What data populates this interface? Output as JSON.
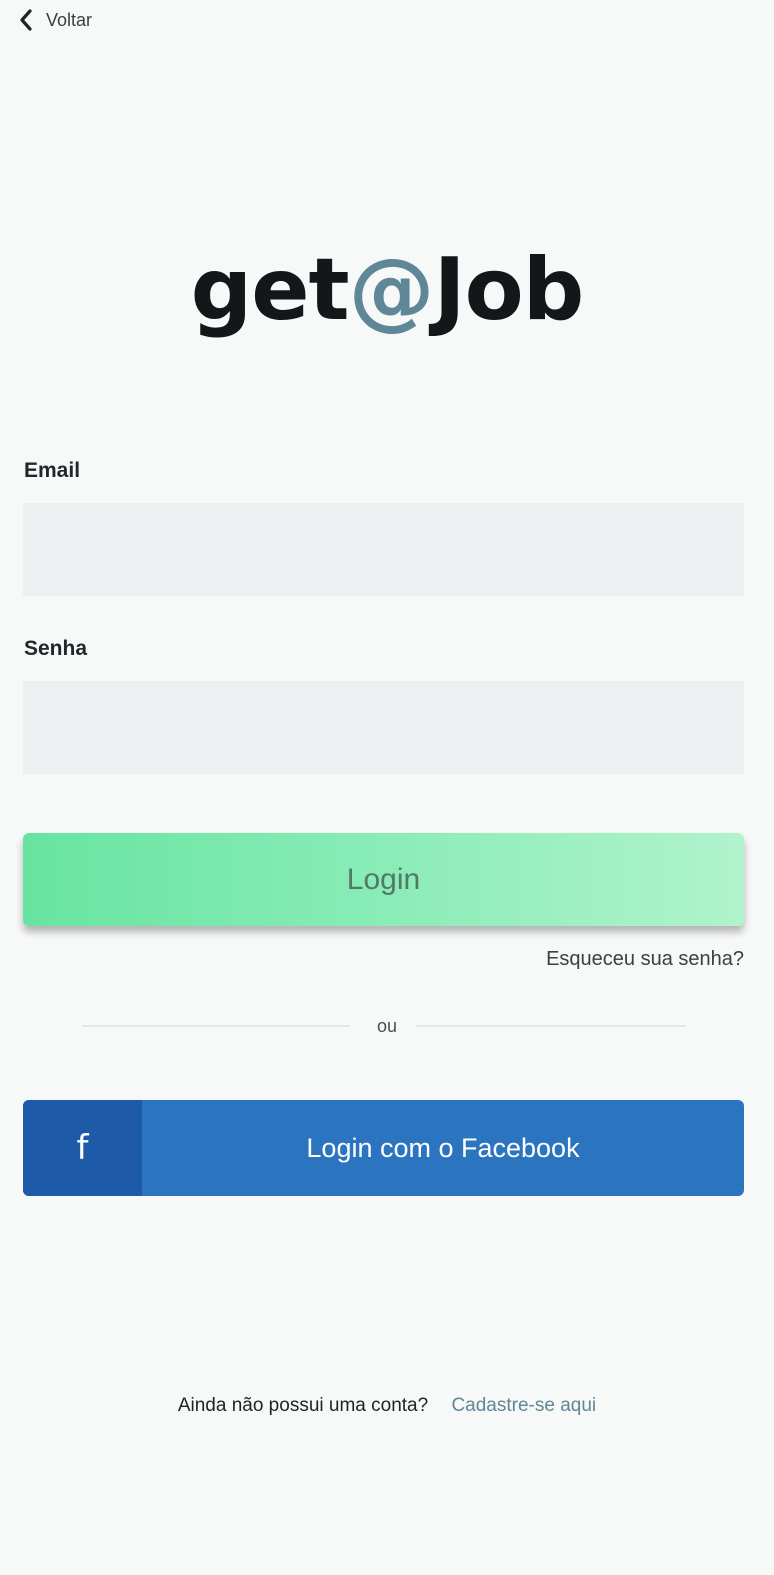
{
  "header": {
    "back_label": "Voltar",
    "back_icon": "chevron-left-icon"
  },
  "logo": {
    "part1": "get",
    "at": "@",
    "part2": "Job",
    "accent_color": "#5f8797"
  },
  "form": {
    "email_label": "Email",
    "email_value": "",
    "password_label": "Senha",
    "password_value": ""
  },
  "login_button": {
    "label": "Login",
    "gradient_start": "#67e4a0",
    "gradient_end": "#b1f3cc"
  },
  "forgot_password": "Esqueceu sua senha?",
  "divider": "ou",
  "facebook_button": {
    "icon": "facebook-icon",
    "icon_glyph": "f",
    "label": "Login com o Facebook",
    "color": "#2b74bf"
  },
  "signup": {
    "question": "Ainda não possui uma conta?",
    "link": "Cadastre-se aqui"
  }
}
